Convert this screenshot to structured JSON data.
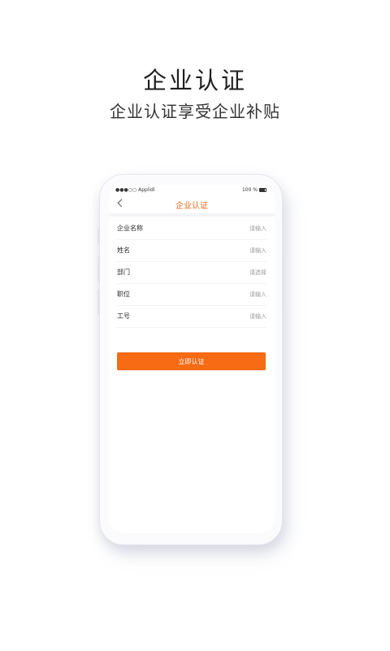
{
  "promo": {
    "title": "企业认证",
    "subtitle": "企业认证享受企业补贴"
  },
  "status_bar": {
    "carrier": "●●●○○ Applidi",
    "battery": "100 %"
  },
  "nav": {
    "title": "企业认证",
    "back_icon": "chevron-left-icon"
  },
  "form": {
    "fields": [
      {
        "label": "企业名称",
        "placeholder": "请输入"
      },
      {
        "label": "姓名",
        "placeholder": "请输入"
      },
      {
        "label": "部门",
        "placeholder": "请选择"
      },
      {
        "label": "职位",
        "placeholder": "请输入"
      },
      {
        "label": "工号",
        "placeholder": "请输入"
      }
    ],
    "submit_label": "立即认证"
  },
  "colors": {
    "accent": "#f66b14",
    "title_accent": "#f06a1a"
  }
}
